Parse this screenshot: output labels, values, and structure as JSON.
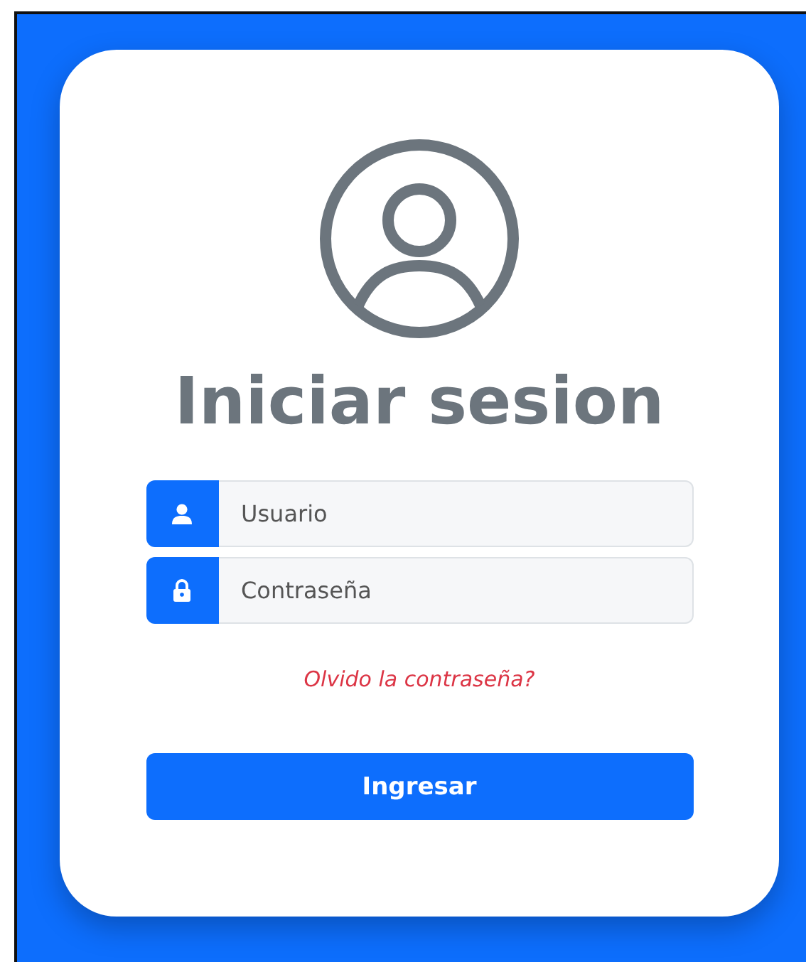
{
  "title": "Iniciar sesion",
  "fields": [
    {
      "kind": "user",
      "placeholder": "Usuario"
    },
    {
      "kind": "password",
      "placeholder": "Contraseña"
    }
  ],
  "forgot_link": "Olvido la contraseña?",
  "submit_button": "Ingresar"
}
